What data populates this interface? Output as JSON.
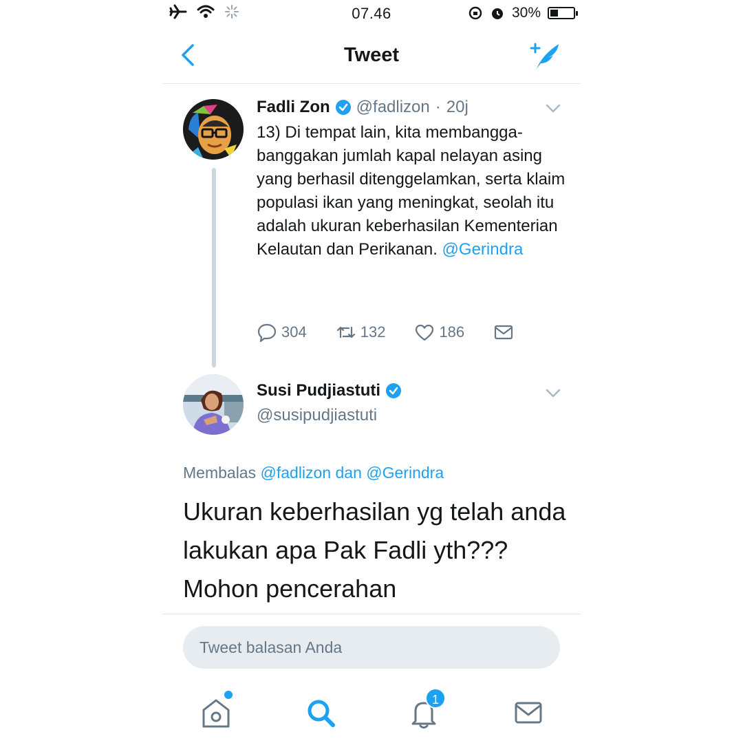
{
  "status_bar": {
    "time": "07.46",
    "battery_percent": "30%",
    "battery_level": 0.3
  },
  "navbar": {
    "title": "Tweet"
  },
  "tweet1": {
    "name": "Fadli Zon",
    "handle": "@fadlizon",
    "separator": "·",
    "time": "20j",
    "text": "13) Di tempat lain, kita membangga-banggakan jumlah kapal nelayan asing yang berhasil ditenggelamkan, serta klaim populasi ikan yang meningkat, seolah itu adalah ukuran keberhasilan Kementerian Kelautan dan Perikanan.",
    "mention": "@Gerindra",
    "replies": "304",
    "retweets": "132",
    "likes": "186"
  },
  "tweet2": {
    "name": "Susi Pudjiastuti",
    "handle": "@susipudjiastuti",
    "reply_prefix": "Membalas",
    "reply_mention1": "@fadlizon",
    "reply_joiner": "dan",
    "reply_mention2": "@Gerindra",
    "text": "Ukuran keberhasilan yg telah anda lakukan apa Pak Fadli yth??? Mohon pencerahan"
  },
  "reply_box": {
    "placeholder": "Tweet balasan Anda"
  },
  "tabbar": {
    "notifications_badge": "1"
  },
  "colors": {
    "accent": "#1da1f2",
    "secondary_text": "#657786"
  },
  "icons": [
    "airplane-icon",
    "wifi-icon",
    "activity-icon",
    "orientation-lock-icon",
    "alarm-icon",
    "battery-icon",
    "back-chevron-icon",
    "compose-tweet-icon",
    "verified-icon",
    "chevron-down-icon",
    "reply-icon",
    "retweet-icon",
    "like-icon",
    "direct-message-icon",
    "home-icon",
    "search-icon",
    "notifications-icon",
    "messages-icon"
  ]
}
